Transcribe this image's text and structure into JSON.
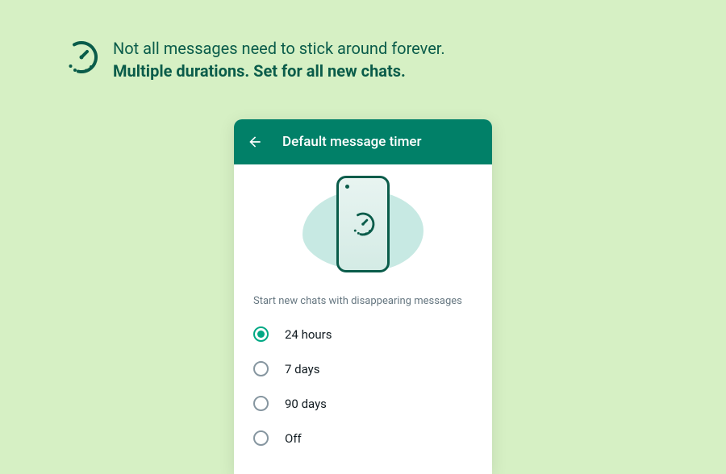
{
  "banner": {
    "line1": "Not all messages need to stick around forever.",
    "line2": "Multiple durations. Set for all new chats."
  },
  "screen": {
    "header_title": "Default message timer",
    "section_label": "Start new chats with disappearing messages",
    "options": [
      {
        "label": "24 hours",
        "selected": true
      },
      {
        "label": "7 days",
        "selected": false
      },
      {
        "label": "90 days",
        "selected": false
      },
      {
        "label": "Off",
        "selected": false
      }
    ]
  },
  "colors": {
    "brand": "#018068",
    "accent": "#00a884",
    "bg": "#d6f0c4"
  }
}
